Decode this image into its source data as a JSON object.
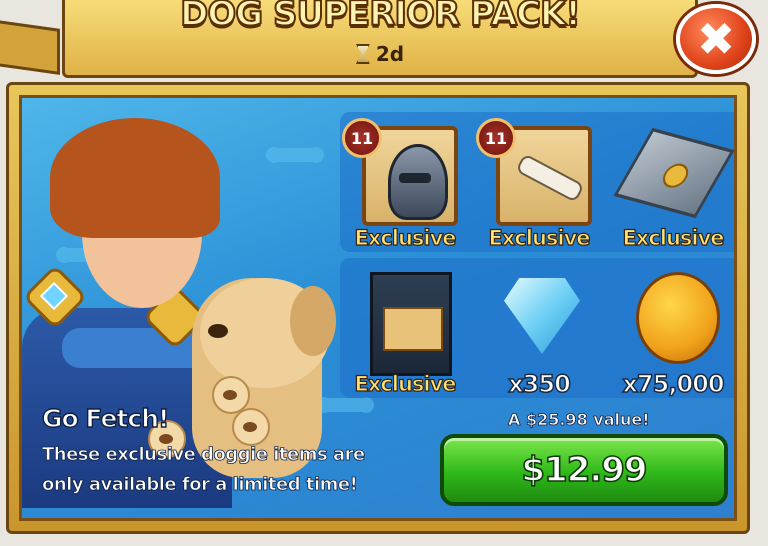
{
  "header": {
    "title": "DOG SUPERIOR PACK!",
    "timer": "2d"
  },
  "close": {
    "glyph": "✖"
  },
  "items": [
    {
      "name": "Helmet",
      "level": "11",
      "label": "Exclusive"
    },
    {
      "name": "Bone Staff",
      "level": "11",
      "label": "Exclusive"
    },
    {
      "name": "Tile",
      "label": "Exclusive"
    },
    {
      "name": "Banner",
      "label": "Exclusive"
    },
    {
      "name": "Gems",
      "label": "x350"
    },
    {
      "name": "Gold",
      "label": "x75,000"
    }
  ],
  "promo": {
    "heading": "Go Fetch!",
    "description": "These exclusive doggie items are only available for a limited time!"
  },
  "offer": {
    "value_text": "A $25.98 value!",
    "price": "$12.99"
  },
  "colors": {
    "banner": "#e0b246",
    "buy_button": "#2fb81a",
    "close_button": "#e0431a",
    "background": "#2a8fd6"
  }
}
